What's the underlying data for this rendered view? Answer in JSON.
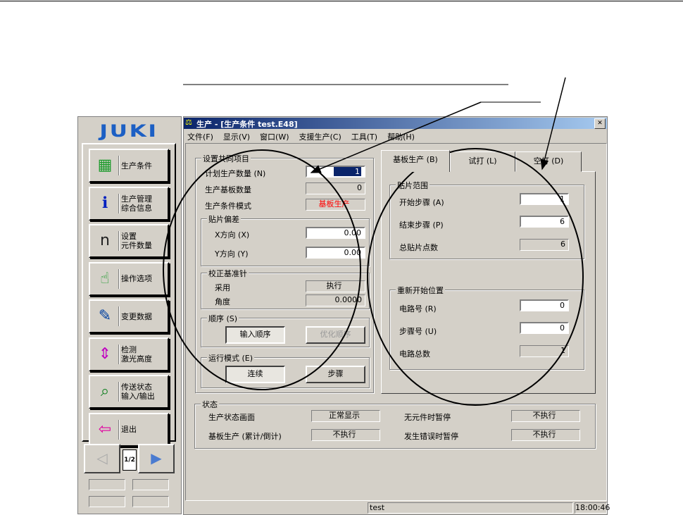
{
  "window": {
    "title": "生产 - [生产条件 test.E48]",
    "close_label": "✕"
  },
  "menu": [
    "文件(F)",
    "显示(V)",
    "窗口(W)",
    "支援生产(C)",
    "工具(T)",
    "帮助(H)"
  ],
  "sidebar": {
    "logo": "JUKI",
    "items": [
      {
        "label": "生产条件",
        "icon": "production-condition-icon"
      },
      {
        "label": "生产管理\n综合信息",
        "icon": "production-info-icon"
      },
      {
        "label": "设置\n元件数量",
        "icon": "component-count-icon"
      },
      {
        "label": "操作选项",
        "icon": "operation-options-icon"
      },
      {
        "label": "变更数据",
        "icon": "edit-data-icon"
      },
      {
        "label": "检测\n激光高度",
        "icon": "laser-height-icon"
      },
      {
        "label": "传送状态\n输入/输出",
        "icon": "conveyor-io-icon"
      },
      {
        "label": "退出",
        "icon": "exit-door-icon"
      }
    ],
    "page": "1/2"
  },
  "common": {
    "title": "设置共同项目",
    "plan_qty_label": "计划生产数量 (N)",
    "plan_qty": "1",
    "board_qty_label": "生产基板数量",
    "board_qty": "0",
    "mode_label": "生产条件模式",
    "mode": "基板生产",
    "offset_title": "贴片偏差",
    "x_label": "X方向 (X)",
    "x": "0.00",
    "y_label": "Y方向 (Y)",
    "y": "0.00",
    "pin_title": "校正基准针",
    "adopt_label": "采用",
    "adopt": "执行",
    "angle_label": "角度",
    "angle": "0.0000",
    "order_title": "顺序 (S)",
    "order_input": "输入顺序",
    "order_opt": "优化顺序",
    "run_title": "运行模式 (E)",
    "run_cont": "连续",
    "run_step": "步骤"
  },
  "tabs": [
    "基板生产 (B)",
    "试打 (L)",
    "空打 (D)"
  ],
  "range": {
    "title": "贴片范围",
    "start_label": "开始步骤 (A)",
    "start": "1",
    "end_label": "结束步骤 (P)",
    "end": "6",
    "total_label": "总贴片点数",
    "total": "6"
  },
  "restart": {
    "title": "重新开始位置",
    "circuit_label": "电路号 (R)",
    "circuit": "0",
    "step_label": "步骤号 (U)",
    "step": "0",
    "total_label": "电路总数",
    "total": "1"
  },
  "status": {
    "title": "状态",
    "r1l": "生产状态画面",
    "r1v": "正常显示",
    "r1l2": "无元件时暂停",
    "r1v2": "不执行",
    "r2l": "基板生产 (累计/倒计)",
    "r2v": "不执行",
    "r2l2": "发生错误时暂停",
    "r2v2": "不执行"
  },
  "statusbar": {
    "text": "test",
    "time": "18:00:46"
  },
  "colors": {
    "titlebar_start": "#0a246a",
    "titlebar_end": "#a6caf0",
    "logo": "#1c5fc4",
    "mode_text": "#ff0000",
    "face": "#d4d0c8"
  }
}
